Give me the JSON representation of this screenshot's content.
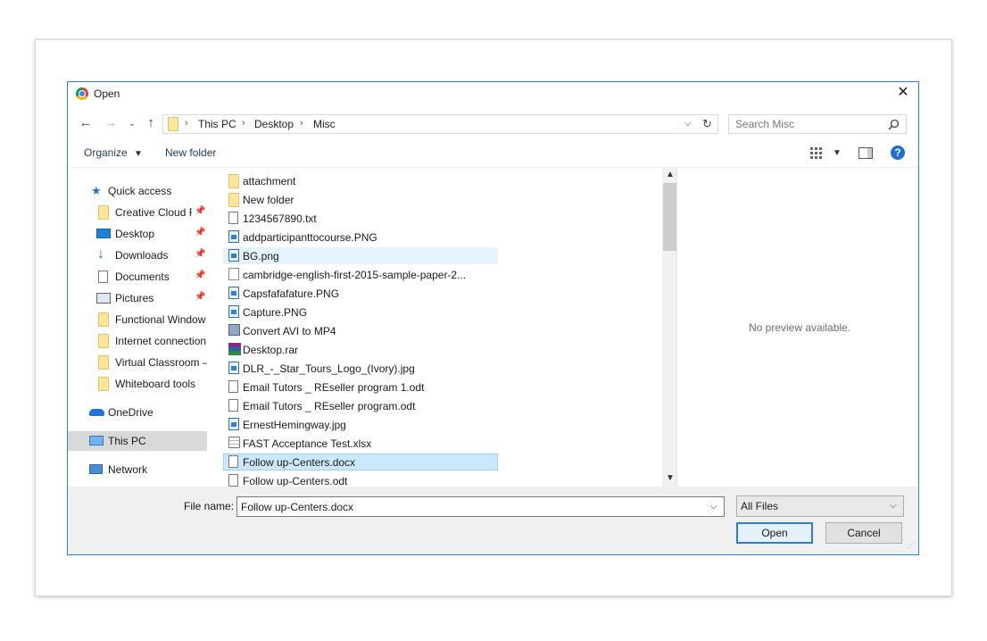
{
  "window": {
    "title": "Open"
  },
  "address": {
    "crumbs": [
      "This PC",
      "Desktop",
      "Misc"
    ]
  },
  "search": {
    "placeholder": "Search Misc"
  },
  "toolbar": {
    "organize_label": "Organize",
    "new_folder_label": "New folder"
  },
  "nav": {
    "items": [
      {
        "label": "Quick access"
      },
      {
        "label": "Creative Cloud F"
      },
      {
        "label": "Desktop"
      },
      {
        "label": "Downloads"
      },
      {
        "label": "Documents"
      },
      {
        "label": "Pictures"
      },
      {
        "label": "Functional Window"
      },
      {
        "label": "Internet connection"
      },
      {
        "label": "Virtual Classroom –"
      },
      {
        "label": "Whiteboard tools"
      },
      {
        "label": "OneDrive"
      },
      {
        "label": "This PC"
      },
      {
        "label": "Network"
      }
    ]
  },
  "files": [
    {
      "name": "attachment",
      "icon": "folder-icon"
    },
    {
      "name": "New folder",
      "icon": "folder-icon"
    },
    {
      "name": "1234567890.txt",
      "icon": "text-file-icon"
    },
    {
      "name": "addparticipanttocourse.PNG",
      "icon": "image-file-icon"
    },
    {
      "name": "BG.png",
      "icon": "image-file-icon"
    },
    {
      "name": "cambridge-english-first-2015-sample-paper-2...",
      "icon": "chrome-file-icon"
    },
    {
      "name": "Capsfafafature.PNG",
      "icon": "image-file-icon"
    },
    {
      "name": "Capture.PNG",
      "icon": "image-file-icon"
    },
    {
      "name": "Convert AVI to MP4",
      "icon": "shortcut-icon"
    },
    {
      "name": "Desktop.rar",
      "icon": "rar-archive-icon"
    },
    {
      "name": "DLR_-_Star_Tours_Logo_(Ivory).jpg",
      "icon": "image-file-icon"
    },
    {
      "name": "Email Tutors _ REseller program 1.odt",
      "icon": "document-file-icon"
    },
    {
      "name": "Email Tutors _ REseller program.odt",
      "icon": "document-file-icon"
    },
    {
      "name": "ErnestHemingway.jpg",
      "icon": "image-file-icon"
    },
    {
      "name": "FAST Acceptance Test.xlsx",
      "icon": "spreadsheet-file-icon"
    },
    {
      "name": "Follow up-Centers.docx",
      "icon": "document-file-icon"
    },
    {
      "name": "Follow up-Centers.odt",
      "icon": "document-file-icon"
    }
  ],
  "preview": {
    "message": "No preview available."
  },
  "bottom": {
    "filename_label": "File name:",
    "filename_value": "Follow up-Centers.docx",
    "filter_value": "All Files",
    "open_label": "Open",
    "cancel_label": "Cancel"
  }
}
